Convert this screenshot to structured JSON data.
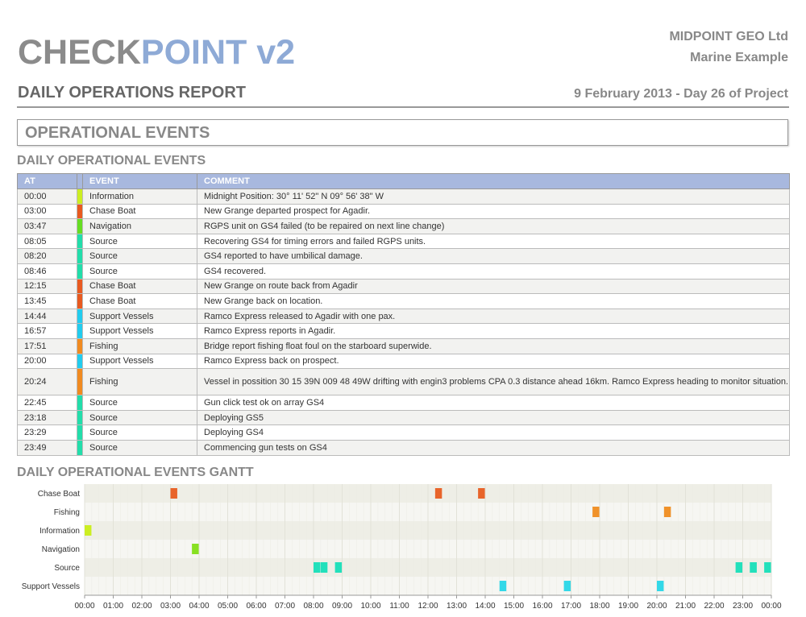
{
  "header": {
    "logo_part1": "CHECK",
    "logo_part2": "POINT v2",
    "company": "MIDPOINT GEO Ltd",
    "project": "Marine Example",
    "report_title": "DAILY OPERATIONS REPORT",
    "report_date": "9 February 2013 - Day 26 of Project"
  },
  "section_title": "OPERATIONAL EVENTS",
  "events_heading": "DAILY OPERATIONAL EVENTS",
  "gantt_heading": "DAILY OPERATIONAL EVENTS GANTT",
  "table": {
    "columns": [
      "AT",
      "",
      "EVENT",
      "COMMENT"
    ],
    "rows": [
      {
        "at": "00:00",
        "event": "Information",
        "comment": "Midnight Position: 30° 11' 52\" N 09° 56' 38\" W",
        "color": "#ccee22"
      },
      {
        "at": "03:00",
        "event": "Chase Boat",
        "comment": "New Grange departed prospect for Agadir.",
        "color": "#e85a20"
      },
      {
        "at": "03:47",
        "event": "Navigation",
        "comment": "RGPS unit on GS4 failed (to be repaired on next line change)",
        "color": "#66dd22"
      },
      {
        "at": "08:05",
        "event": "Source",
        "comment": "Recovering GS4 for timing errors and failed RGPS units.",
        "color": "#22ddaa"
      },
      {
        "at": "08:20",
        "event": "Source",
        "comment": "GS4 reported to have umbilical damage.",
        "color": "#22ddaa"
      },
      {
        "at": "08:46",
        "event": "Source",
        "comment": "GS4 recovered.",
        "color": "#22ddaa"
      },
      {
        "at": "12:15",
        "event": "Chase Boat",
        "comment": "New Grange on route back from Agadir",
        "color": "#e85a20"
      },
      {
        "at": "13:45",
        "event": "Chase Boat",
        "comment": "New Grange back on location.",
        "color": "#e85a20"
      },
      {
        "at": "14:44",
        "event": "Support Vessels",
        "comment": "Ramco Express released to Agadir with one pax.",
        "color": "#22ccee"
      },
      {
        "at": "16:57",
        "event": "Support Vessels",
        "comment": "Ramco Express reports in Agadir.",
        "color": "#22ccee"
      },
      {
        "at": "17:51",
        "event": "Fishing",
        "comment": "Bridge report fishing float foul on the starboard superwide.",
        "color": "#f08a20"
      },
      {
        "at": "20:00",
        "event": "Support Vessels",
        "comment": "Ramco Express back on prospect.",
        "color": "#22ccee"
      },
      {
        "at": "20:24",
        "event": "Fishing",
        "comment": "Vessel in possition 30 15 39N 009 48 49W drifting with engin3 problems CPA 0.3 distance ahead 16km. Ramco Express heading to monitor situation.",
        "color": "#f08a20"
      },
      {
        "at": "22:45",
        "event": "Source",
        "comment": "Gun click test ok on array GS4",
        "color": "#22ddaa"
      },
      {
        "at": "23:18",
        "event": "Source",
        "comment": "Deploying GS5",
        "color": "#22ddaa"
      },
      {
        "at": "23:29",
        "event": "Source",
        "comment": "Deploying GS4",
        "color": "#22ddaa"
      },
      {
        "at": "23:49",
        "event": "Source",
        "comment": "Commencing gun tests on GS4",
        "color": "#22ddaa"
      }
    ]
  },
  "chart_data": {
    "type": "gantt",
    "categories": [
      "Chase Boat",
      "Fishing",
      "Information",
      "Navigation",
      "Source",
      "Support Vessels"
    ],
    "x_ticks": [
      "00:00",
      "01:00",
      "02:00",
      "03:00",
      "04:00",
      "05:00",
      "06:00",
      "07:00",
      "08:00",
      "09:00",
      "10:00",
      "11:00",
      "12:00",
      "13:00",
      "14:00",
      "15:00",
      "16:00",
      "17:00",
      "18:00",
      "19:00",
      "20:00",
      "21:00",
      "22:00",
      "23:00",
      "00:00"
    ],
    "xlim_hours": [
      0,
      24
    ],
    "colors": {
      "Chase Boat": "#e8642a",
      "Fishing": "#f0922a",
      "Information": "#ccee22",
      "Navigation": "#88e022",
      "Source": "#22e0bb",
      "Support Vessels": "#33d8e8"
    },
    "events": [
      {
        "category": "Information",
        "start": "00:00"
      },
      {
        "category": "Chase Boat",
        "start": "03:00"
      },
      {
        "category": "Navigation",
        "start": "03:47"
      },
      {
        "category": "Source",
        "start": "08:05"
      },
      {
        "category": "Source",
        "start": "08:20"
      },
      {
        "category": "Source",
        "start": "08:46"
      },
      {
        "category": "Chase Boat",
        "start": "12:15"
      },
      {
        "category": "Chase Boat",
        "start": "13:45"
      },
      {
        "category": "Support Vessels",
        "start": "14:44"
      },
      {
        "category": "Support Vessels",
        "start": "16:57"
      },
      {
        "category": "Fishing",
        "start": "17:51"
      },
      {
        "category": "Support Vessels",
        "start": "20:00"
      },
      {
        "category": "Fishing",
        "start": "20:24"
      },
      {
        "category": "Source",
        "start": "22:45"
      },
      {
        "category": "Source",
        "start": "23:18"
      },
      {
        "category": "Source",
        "start": "23:29"
      },
      {
        "category": "Source",
        "start": "23:49"
      }
    ]
  }
}
